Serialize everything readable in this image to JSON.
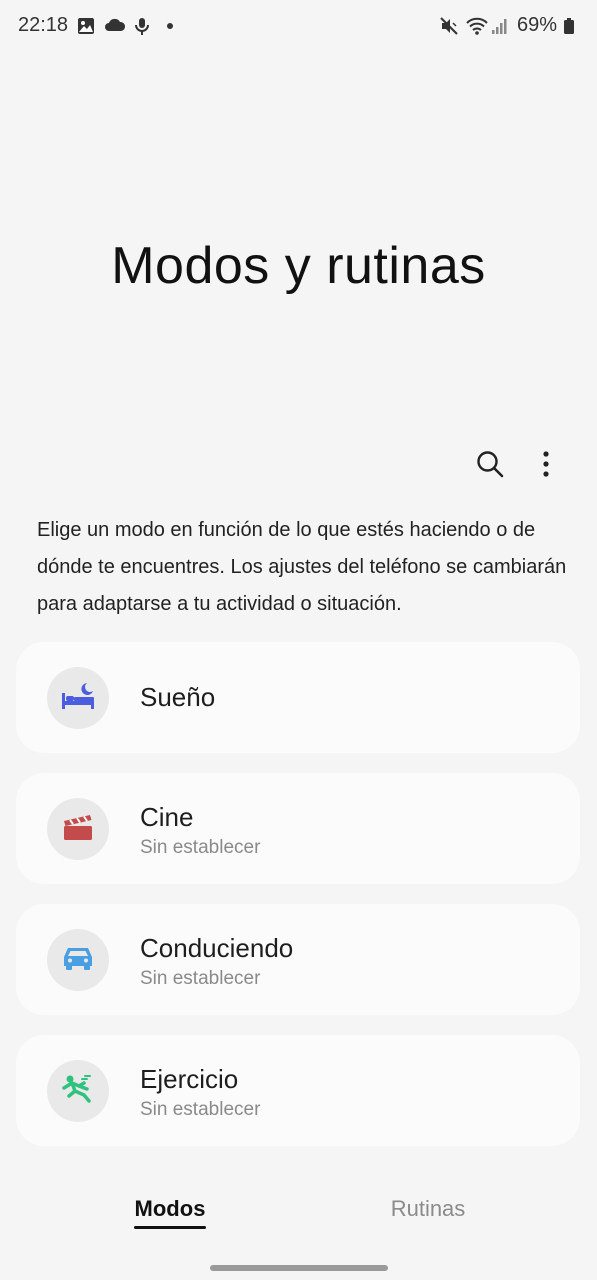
{
  "status_bar": {
    "time": "22:18",
    "battery": "69%",
    "icons_left": [
      "gallery-icon",
      "cloud-icon",
      "mic-icon",
      "dot-icon"
    ],
    "icons_right": [
      "vibrate-mute-icon",
      "wifi-icon",
      "signal-icon",
      "battery-icon"
    ]
  },
  "page": {
    "title": "Modos y rutinas",
    "description": "Elige un modo en función de lo que estés haciendo o de dónde te encuentres. Los ajustes del teléfono se cambiarán para adaptarse a tu actividad o situación."
  },
  "toolbar": {
    "search_icon": "search-icon",
    "more_icon": "more-vert-icon"
  },
  "modes": [
    {
      "name": "Sueño",
      "status": "",
      "icon": "bed-icon",
      "color": "#4b5ee0"
    },
    {
      "name": "Cine",
      "status": "Sin establecer",
      "icon": "clapperboard-icon",
      "color": "#c44b4b"
    },
    {
      "name": "Conduciendo",
      "status": "Sin establecer",
      "icon": "car-icon",
      "color": "#4a9fe3"
    },
    {
      "name": "Ejercicio",
      "status": "Sin establecer",
      "icon": "running-icon",
      "color": "#2ec27e"
    }
  ],
  "tabs": [
    {
      "label": "Modos",
      "selected": true
    },
    {
      "label": "Rutinas",
      "selected": false
    }
  ]
}
